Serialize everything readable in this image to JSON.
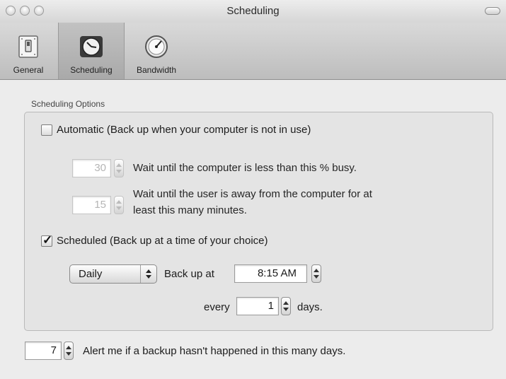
{
  "window": {
    "title": "Scheduling"
  },
  "toolbar": {
    "items": [
      {
        "label": "General",
        "icon": "switch-icon",
        "selected": false
      },
      {
        "label": "Scheduling",
        "icon": "clock-icon",
        "selected": true
      },
      {
        "label": "Bandwidth",
        "icon": "gauge-icon",
        "selected": false
      }
    ]
  },
  "options": {
    "group_label": "Scheduling Options",
    "automatic": {
      "checked": false,
      "label": "Automatic (Back up when your computer is not in use)",
      "busy_value": "30",
      "busy_text": "Wait until the computer is less than this % busy.",
      "idle_value": "15",
      "idle_text_line1": "Wait until the user is away from the computer for at",
      "idle_text_line2": "least this many minutes."
    },
    "scheduled": {
      "checked": true,
      "checkmark": "✓",
      "label": "Scheduled (Back up at a time of your choice)",
      "frequency": "Daily",
      "backup_at_label": "Back up at",
      "time": "8:15 AM",
      "every_label": "every",
      "every_value": "1",
      "days_label": "days."
    }
  },
  "alert": {
    "value": "7",
    "text": "Alert me if a backup hasn't happened in this many days."
  }
}
